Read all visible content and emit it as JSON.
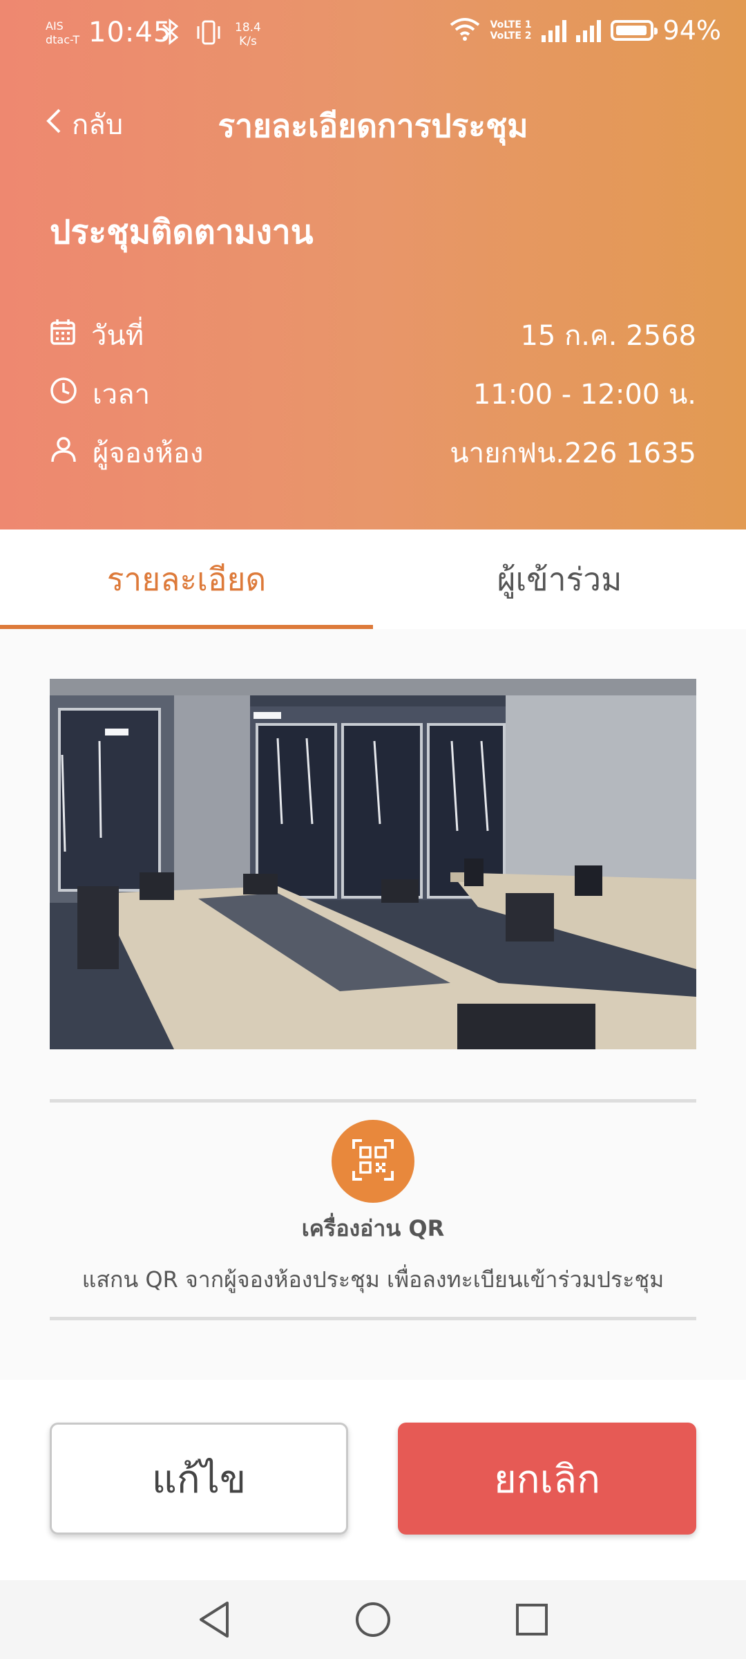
{
  "status_bar": {
    "carrier_1": "AIS",
    "carrier_2": "dtac-T",
    "time": "10:45",
    "net_speed_value": "18.4",
    "net_speed_unit": "K/s",
    "volte_1": "VoLTE 1",
    "volte_2": "VoLTE 2",
    "battery_percent": "94%",
    "icons": [
      "bluetooth-icon",
      "vibrate-icon",
      "wifi-icon",
      "signal-icon",
      "battery-icon"
    ]
  },
  "header": {
    "back_label": "กลับ",
    "title": "รายละเอียดการประชุม",
    "meeting_title": "ประชุมติดตามงาน",
    "info": [
      {
        "label": "วันที่",
        "value": "15 ก.ค. 2568",
        "icon": "calendar-icon"
      },
      {
        "label": "เวลา",
        "value": "11:00 - 12:00 น.",
        "icon": "clock-icon"
      },
      {
        "label": "ผู้จองห้อง",
        "value": "นายกฟน.226 1635",
        "icon": "person-icon"
      }
    ]
  },
  "tabs": [
    {
      "label": "รายละเอียด",
      "active": true
    },
    {
      "label": "ผู้เข้าร่วม",
      "active": false
    }
  ],
  "qr": {
    "title": "เครื่องอ่าน QR",
    "description": "แสกน QR จากผู้จองห้องประชุม เพื่อลงทะเบียนเข้าร่วมประชุม"
  },
  "actions": {
    "edit_label": "แก้ไข",
    "cancel_label": "ยกเลิก"
  },
  "colors": {
    "header_gradient_start": "#ee8870",
    "header_gradient_end": "#e29a52",
    "accent": "#dd7a3a",
    "cancel": "#e65a55",
    "qr_circle": "#e8883c"
  }
}
